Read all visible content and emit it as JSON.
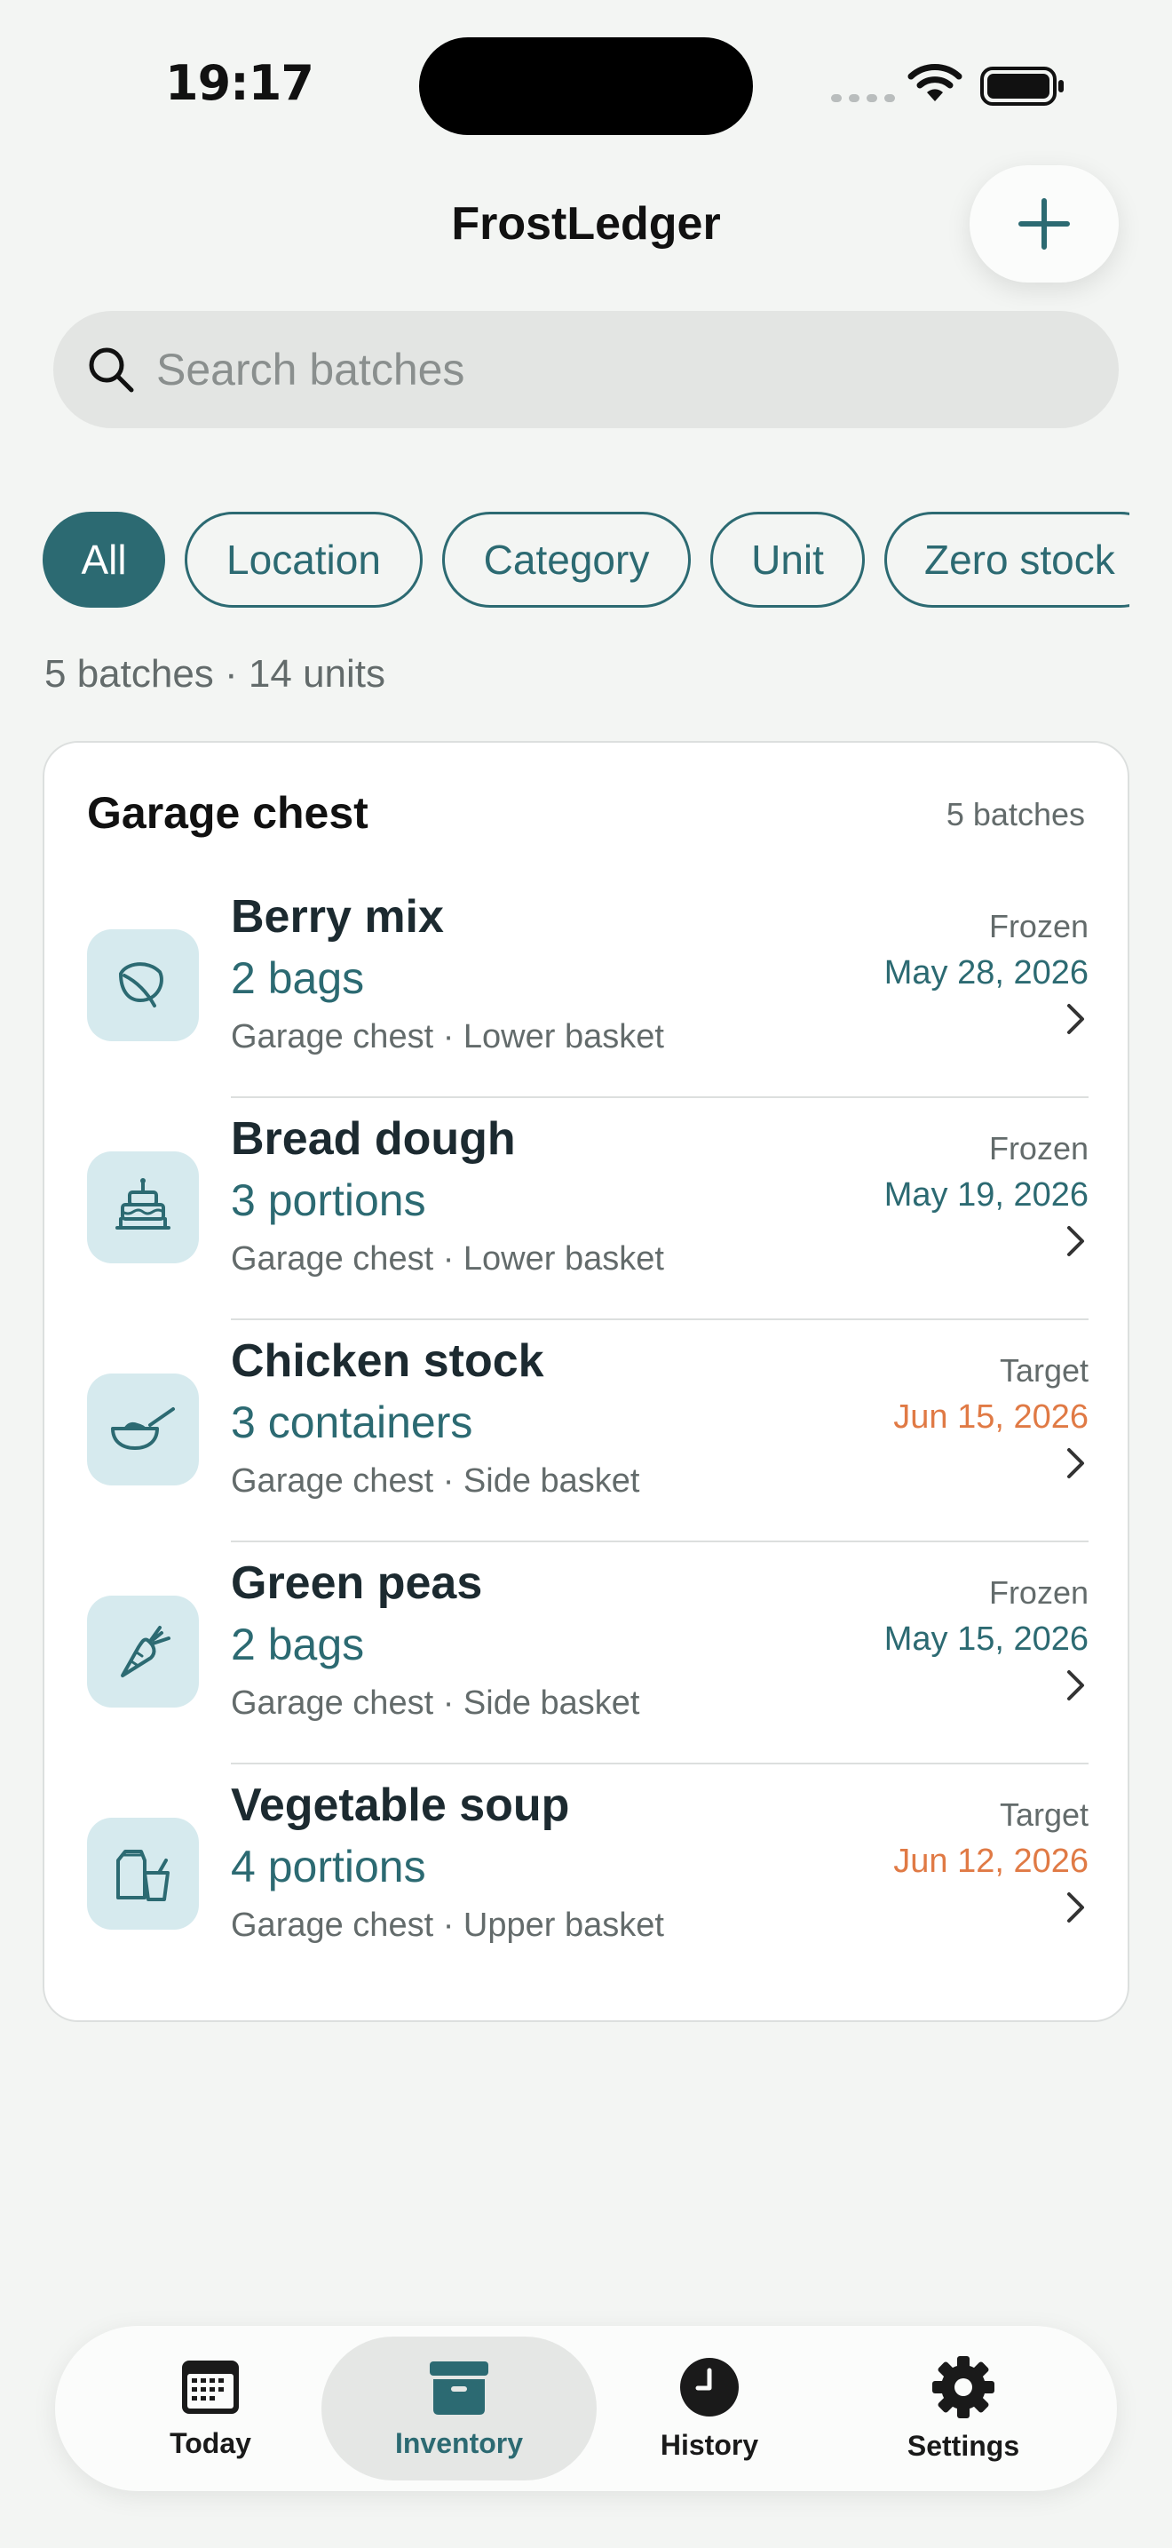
{
  "status_bar": {
    "time": "19:17"
  },
  "header": {
    "title": "FrostLedger",
    "add_icon": "plus-icon"
  },
  "search": {
    "placeholder": "Search batches",
    "value": ""
  },
  "filters": [
    {
      "label": "All",
      "active": true
    },
    {
      "label": "Location",
      "active": false
    },
    {
      "label": "Category",
      "active": false
    },
    {
      "label": "Unit",
      "active": false
    },
    {
      "label": "Zero stock",
      "active": false
    }
  ],
  "summary": "5 batches · 14 units",
  "group": {
    "title": "Garage chest",
    "count": "5 batches",
    "items": [
      {
        "name": "Berry mix",
        "quantity": "2 bags",
        "location": "Garage chest · Lower basket",
        "state": "Frozen",
        "date": "May 28, 2026",
        "icon": "leaf-icon",
        "date_color": "#2c6a72"
      },
      {
        "name": "Bread dough",
        "quantity": "3 portions",
        "location": "Garage chest · Lower basket",
        "state": "Frozen",
        "date": "May 19, 2026",
        "icon": "cake-icon",
        "date_color": "#2c6a72"
      },
      {
        "name": "Chicken stock",
        "quantity": "3 containers",
        "location": "Garage chest · Side basket",
        "state": "Target",
        "date": "Jun 15, 2026",
        "icon": "bowl-icon",
        "date_color": "#e07a45"
      },
      {
        "name": "Green peas",
        "quantity": "2 bags",
        "location": "Garage chest · Side basket",
        "state": "Frozen",
        "date": "May 15, 2026",
        "icon": "carrot-icon",
        "date_color": "#2c6a72"
      },
      {
        "name": "Vegetable soup",
        "quantity": "4 portions",
        "location": "Garage chest · Upper basket",
        "state": "Target",
        "date": "Jun 12, 2026",
        "icon": "jar-cup-icon",
        "date_color": "#e07a45"
      }
    ]
  },
  "tabs": [
    {
      "label": "Today",
      "icon": "calendar-icon",
      "active": false
    },
    {
      "label": "Inventory",
      "icon": "archive-box-icon",
      "active": true
    },
    {
      "label": "History",
      "icon": "clock-icon",
      "active": false
    },
    {
      "label": "Settings",
      "icon": "gear-icon",
      "active": false
    }
  ],
  "colors": {
    "accent": "#2c6a72",
    "target": "#e07a45",
    "tile": "#d6eaee",
    "background": "#f3f5f3"
  }
}
